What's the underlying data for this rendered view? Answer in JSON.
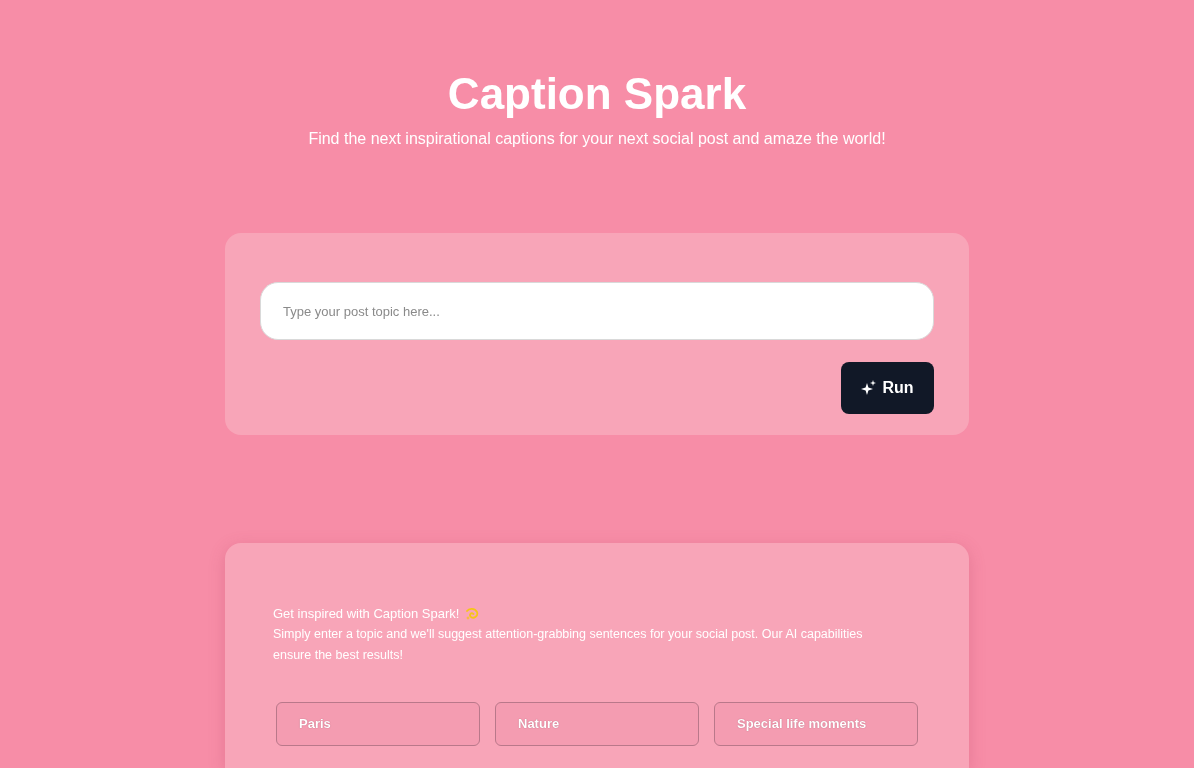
{
  "header": {
    "title": "Caption Spark",
    "subtitle": "Find the next inspirational captions for your next social post and amaze the world!"
  },
  "prompt_card": {
    "input": {
      "placeholder": "Type your post topic here..."
    },
    "run_button": {
      "label": "Run"
    }
  },
  "info_card": {
    "heading": "Get inspired with Caption Spark!",
    "text": "Simply enter a topic and we'll suggest attention-grabbing sentences for your social post. Our AI capabilities ensure the best results!",
    "suggestions": [
      {
        "label": "Paris"
      },
      {
        "label": "Nature"
      },
      {
        "label": "Special life moments"
      }
    ]
  }
}
